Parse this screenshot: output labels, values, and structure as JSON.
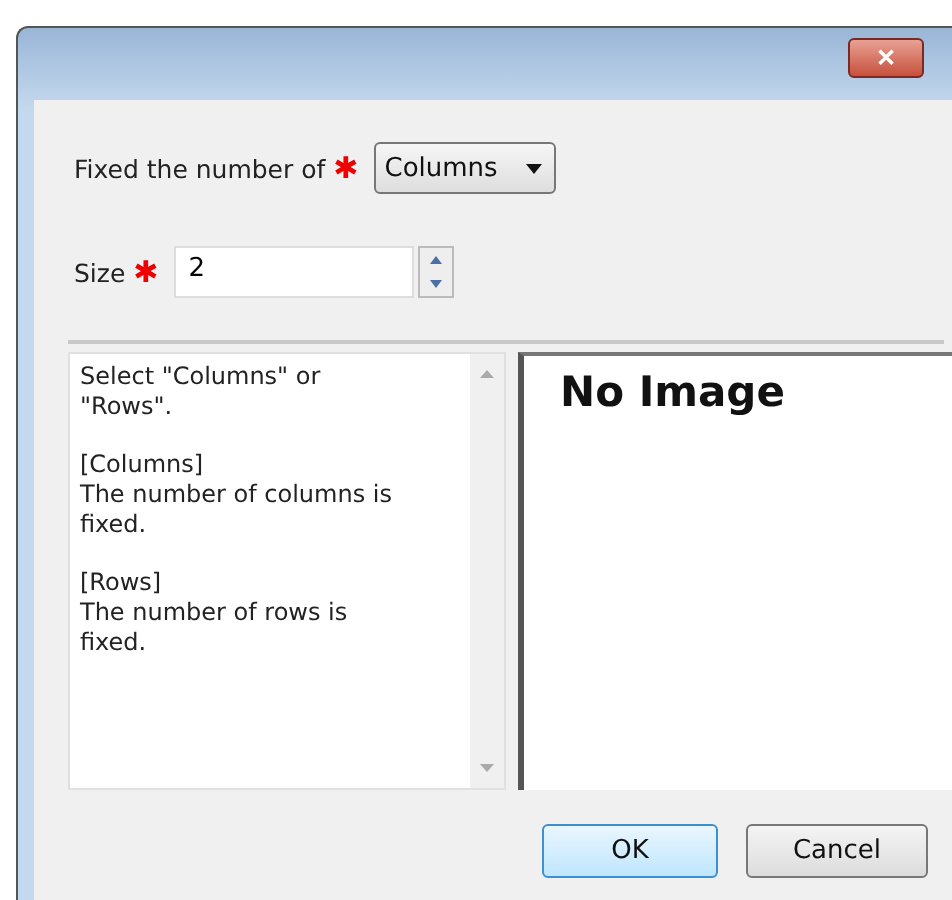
{
  "window": {
    "close_label": "✕"
  },
  "fixed_field": {
    "label": "Fixed the number of",
    "required_mark": "✱",
    "value": "Columns"
  },
  "size_field": {
    "label": "Size",
    "required_mark": "✱",
    "value": "2"
  },
  "help_text": [
    [
      "Select \"Columns\" or",
      "\"Rows\"."
    ],
    [
      "[Columns]",
      "The number of columns is",
      "fixed."
    ],
    [
      "[Rows]",
      "The number of rows is",
      "fixed."
    ]
  ],
  "preview": {
    "text": "No Image"
  },
  "buttons": [
    {
      "label": "OK",
      "default": true
    },
    {
      "label": "Cancel",
      "default": false
    }
  ]
}
